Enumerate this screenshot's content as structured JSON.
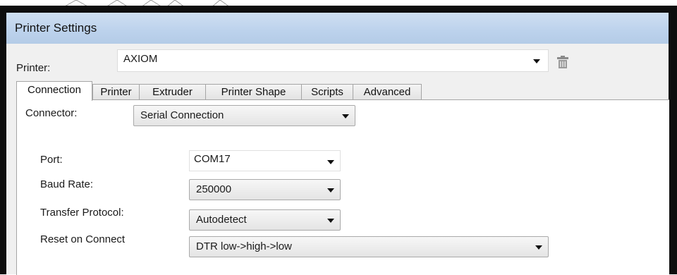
{
  "window": {
    "title": "Printer Settings"
  },
  "printer": {
    "label": "Printer:",
    "value": "AXIOM"
  },
  "tabs": [
    {
      "label": "Connection",
      "active": true
    },
    {
      "label": "Printer",
      "active": false
    },
    {
      "label": "Extruder",
      "active": false
    },
    {
      "label": "Printer Shape",
      "active": false
    },
    {
      "label": "Scripts",
      "active": false
    },
    {
      "label": "Advanced",
      "active": false
    }
  ],
  "connection": {
    "connector_label": "Connector:",
    "connector_value": "Serial Connection",
    "port_label": "Port:",
    "port_value": "COM17",
    "baud_label": "Baud Rate:",
    "baud_value": "250000",
    "protocol_label": "Transfer Protocol:",
    "protocol_value": "Autodetect",
    "reset_label": "Reset on Connect",
    "reset_value": "DTR low->high->low"
  },
  "icons": {
    "delete": "trash-icon",
    "dropdown": "dropdown-arrow-icon"
  },
  "colors": {
    "titlebar": "#bcd2ec",
    "frame": "#0e0e0e",
    "client": "#f0f0f0"
  }
}
